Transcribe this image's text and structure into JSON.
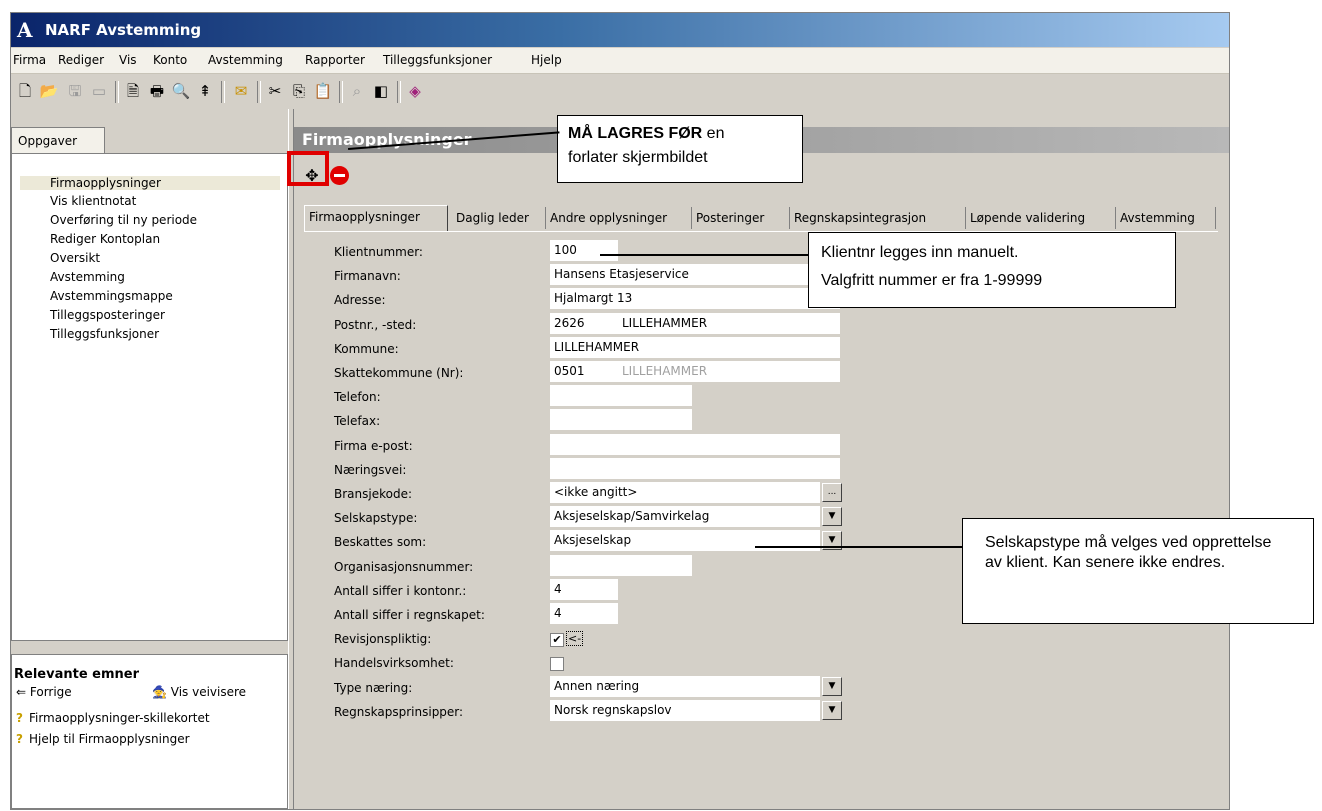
{
  "window": {
    "title": "NARF Avstemming",
    "app_icon": "A"
  },
  "menu": [
    "Firma",
    "Rediger",
    "Vis",
    "Konto",
    "Avstemming",
    "Rapporter",
    "Tilleggsfunksjoner",
    "Hjelp"
  ],
  "toolbar_icons": [
    "new-icon",
    "open-icon",
    "save-icon",
    "close-icon",
    "preview-icon",
    "print-icon",
    "print-preview-icon",
    "export-icon",
    "email-icon",
    "spellcheck-icon",
    "cut-icon",
    "copy-icon",
    "paste-icon",
    "find-icon",
    "panel-icon",
    "book-icon"
  ],
  "left": {
    "tab": "Oppgaver",
    "tasks": [
      "Firmaopplysninger",
      "Vis klientnotat",
      "Overføring til ny periode",
      "Rediger Kontoplan",
      "Oversikt",
      "Avstemming",
      "Avstemmingsmappe",
      "Tilleggsposteringer",
      "Tilleggsfunksjoner"
    ],
    "related": {
      "title": "Relevante emner",
      "back": "Forrige",
      "wizards": "Vis veivisere",
      "items": [
        "Firmaopplysninger-skillekortet",
        "Hjelp til Firmaopplysninger"
      ]
    }
  },
  "section_title": "Firmaopplysninger",
  "tabs": [
    "Firmaopplysninger",
    "Daglig leder",
    "Andre opplysninger",
    "Posteringer",
    "Regnskapsintegrasjon",
    "Løpende validering",
    "Avstemming"
  ],
  "form": {
    "labels": {
      "klientnummer": "Klientnummer:",
      "firmanavn": "Firmanavn:",
      "adresse": "Adresse:",
      "postnr": "Postnr., -sted:",
      "kommune": "Kommune:",
      "skattekommune": "Skattekommune (Nr):",
      "telefon": "Telefon:",
      "telefax": "Telefax:",
      "epost": "Firma e-post:",
      "naeringsvei": "Næringsvei:",
      "bransjekode": "Bransjekode:",
      "selskapstype": "Selskapstype:",
      "beskattes": "Beskattes som:",
      "orgnr": "Organisasjonsnummer:",
      "siffer_konto": "Antall siffer i kontonr.:",
      "siffer_regnskap": "Antall siffer i regnskapet:",
      "revisjon": "Revisjonspliktig:",
      "handel": "Handelsvirksomhet:",
      "type_naering": "Type næring:",
      "prinsipper": "Regnskapsprinsipper:"
    },
    "values": {
      "klientnummer": "100",
      "firmanavn": "Hansens Etasjeservice",
      "adresse": "Hjalmargt 13",
      "postnr": "2626",
      "poststed": "LILLEHAMMER",
      "kommune": "LILLEHAMMER",
      "skattekommune_nr": "0501",
      "skattekommune_navn": "LILLEHAMMER",
      "telefon": "",
      "telefax": "",
      "epost": "",
      "naeringsvei": "",
      "bransjekode": "<ikke angitt>",
      "bransjekode_btn": "...",
      "selskapstype": "Aksjeselskap/Samvirkelag",
      "beskattes": "Aksjeselskap",
      "orgnr": "",
      "siffer_konto": "4",
      "siffer_regnskap": "4",
      "revisjon_checked": "✔",
      "revisjon_extra": "<-",
      "handel_checked": "",
      "type_naering": "Annen næring",
      "prinsipper": "Norsk regnskapslov"
    }
  },
  "callouts": {
    "save_bold": "MÅ LAGRES FØR",
    "save_rest": " en",
    "save_line2": "forlater skjermbildet",
    "klient_line1": "Klientnr legges inn manuelt.",
    "klient_line2": "Valgfritt nummer er fra 1-99999",
    "selskap": "Selskapstype må velges ved opprettelse av klient. Kan senere ikke endres."
  },
  "colors": {
    "title_start": "#0a246a",
    "title_end": "#a6caf0",
    "highlight": "#e00000"
  }
}
